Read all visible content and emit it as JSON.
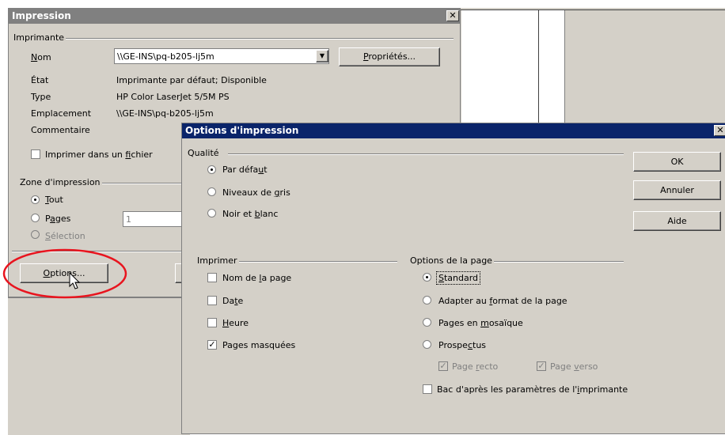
{
  "impression": {
    "title": "Impression",
    "printer_group": "Imprimante",
    "name_label_pre": "",
    "name_label_u": "N",
    "name_label_post": "om",
    "name_value": "\\\\GE-INS\\pq-b205-lj5m",
    "properties_button_pre": "",
    "properties_button_u": "P",
    "properties_button_post": "ropriétés...",
    "status_label": "État",
    "status_value": "Imprimante par défaut; Disponible",
    "type_label": "Type",
    "type_value": "HP Color LaserJet 5/5M PS",
    "location_label": "Emplacement",
    "location_value": "\\\\GE-INS\\pq-b205-lj5m",
    "comment_label": "Commentaire",
    "print_to_file_pre": "Imprimer dans un ",
    "print_to_file_u": "f",
    "print_to_file_post": "ichier",
    "print_area_group": "Zone d'impression",
    "all_pre": "",
    "all_u": "T",
    "all_post": "out",
    "pages_pre": "P",
    "pages_u": "a",
    "pages_post": "ges",
    "pages_value": "1",
    "selection_pre": "",
    "selection_u": "S",
    "selection_post": "élection",
    "options_button_pre": "",
    "options_button_u": "O",
    "options_button_post": "ptions..."
  },
  "options": {
    "title": "Options d'impression",
    "quality_group": "Qualité",
    "quality_default_pre": "Par défa",
    "quality_default_u": "u",
    "quality_default_post": "t",
    "quality_gray_pre": "Niveaux de ",
    "quality_gray_u": "g",
    "quality_gray_post": "ris",
    "quality_bw_pre": "Noir et ",
    "quality_bw_u": "b",
    "quality_bw_post": "lanc",
    "ok_label": "OK",
    "cancel_label": "Annuler",
    "help_label": "Aide",
    "print_group": "Imprimer",
    "page_name_pre": "Nom de ",
    "page_name_u": "l",
    "page_name_post": "a page",
    "date_pre": "Da",
    "date_u": "t",
    "date_post": "e",
    "time_pre": "",
    "time_u": "H",
    "time_post": "eure",
    "hidden_pages": "Pages masquées",
    "page_options_group": "Options de la page",
    "standard_pre": "",
    "standard_u": "S",
    "standard_post": "tandard",
    "fit_pre": "Adapter au ",
    "fit_u": "f",
    "fit_post": "ormat de la page",
    "tile_pre": "Pages en ",
    "tile_u": "m",
    "tile_post": "osaïque",
    "brochure_pre": "Prospe",
    "brochure_u": "c",
    "brochure_post": "tus",
    "front_pre": "Page ",
    "front_u": "r",
    "front_post": "ecto",
    "back_pre": "Page ",
    "back_u": "v",
    "back_post": "erso",
    "tray_pre": "Bac d'après les paramètres de l'",
    "tray_u": "i",
    "tray_post": "mprimante"
  },
  "colors": {
    "titlebar_inactive": "#808080",
    "titlebar_active": "#0a246a",
    "highlight_ellipse": "#e8141e"
  },
  "icons": [
    "dropdown-arrow-icon",
    "close-icon",
    "mouse-cursor-icon"
  ]
}
